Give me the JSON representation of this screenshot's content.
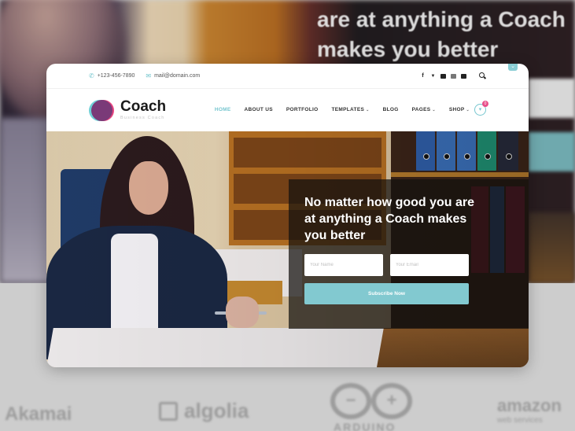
{
  "background": {
    "heading_line1": "are at anything a Coach",
    "heading_line2": "makes you better",
    "partner_logos": [
      {
        "name": "Akamai",
        "label": "Akamai"
      },
      {
        "name": "algolia",
        "label": "algolia"
      },
      {
        "name": "Arduino",
        "symbols": [
          "−",
          "+"
        ],
        "label": "ARDUINO"
      },
      {
        "name": "amazon web services",
        "label": "amazon",
        "sublabel": "web services"
      }
    ]
  },
  "topbar": {
    "phone_icon": "phone-icon",
    "phone": "+123-456-7890",
    "email_icon": "mail-icon",
    "email": "mail@domain.com",
    "social": [
      {
        "icon": "facebook-icon",
        "glyph": "f"
      },
      {
        "icon": "twitter-icon",
        "glyph": "🐦"
      },
      {
        "icon": "youtube-icon",
        "glyph": ""
      },
      {
        "icon": "instagram-icon",
        "glyph": ""
      },
      {
        "icon": "behance-icon",
        "glyph": ""
      }
    ],
    "search_icon": "search-icon",
    "collapse_glyph": "⌄"
  },
  "brand": {
    "name": "Coach",
    "tagline": "Business Coach",
    "colors": {
      "teal": "#6fd0d6",
      "pink": "#e7447f",
      "purple": "#7a3a78"
    }
  },
  "nav": {
    "items": [
      {
        "label": "HOME",
        "active": true,
        "dropdown": false
      },
      {
        "label": "ABOUT US",
        "active": false,
        "dropdown": false
      },
      {
        "label": "PORTFOLIO",
        "active": false,
        "dropdown": false
      },
      {
        "label": "TEMPLATES",
        "active": false,
        "dropdown": true
      },
      {
        "label": "BLOG",
        "active": false,
        "dropdown": false
      },
      {
        "label": "PAGES",
        "active": false,
        "dropdown": true
      },
      {
        "label": "SHOP",
        "active": false,
        "dropdown": true
      }
    ],
    "chevron": "⌄",
    "cart_glyph": "🛒",
    "cart_count": "0",
    "accent_color": "#76c6cf",
    "badge_color": "#e8508a"
  },
  "hero": {
    "headline": "No matter how good you are at anything a Coach makes you better",
    "name_placeholder": "Your Name",
    "email_placeholder": "Your Email",
    "subscribe_label": "Subscribe Now",
    "button_color": "#82c9d0"
  }
}
